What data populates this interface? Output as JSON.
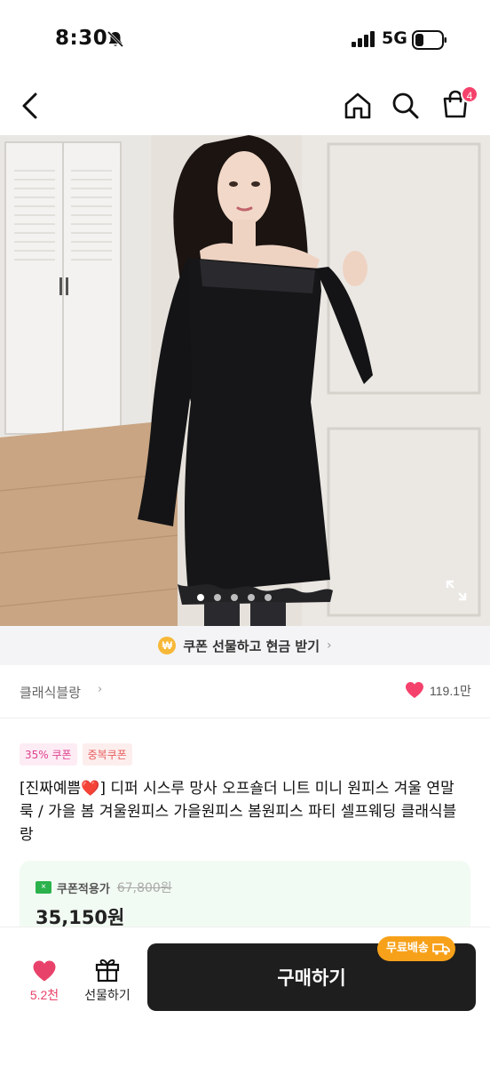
{
  "status_bar": {
    "time": "8:30",
    "network": "5G"
  },
  "nav": {
    "cart_count": "4"
  },
  "hero": {
    "image_count": 5,
    "active_index": 0
  },
  "coupon_banner": {
    "icon_text": "₩",
    "text": "쿠폰 선물하고 현금 받기",
    "chevron": "›"
  },
  "shop": {
    "name": "클래식블랑",
    "chevron": "›",
    "like_count": "119.1만"
  },
  "tags": [
    "35% 쿠폰",
    "중복쿠폰"
  ],
  "product": {
    "title": "[진짜예쁨❤️] 디퍼 시스루 망사 오프숄더 니트 미니 원피스 겨울 연말룩 / 가을 봄 겨울원피스 가을원피스 봄원피스 파티 셀프웨딩 클래식블랑"
  },
  "price": {
    "coupon_label": "쿠폰적용가",
    "original": "67,800원",
    "sale": "35,150원"
  },
  "bottom_bar": {
    "like_count": "5.2천",
    "gift_label": "선물하기",
    "buy_label": "구매하기",
    "free_shipping": "무료배송"
  },
  "colors": {
    "accent_pink": "#f5426c",
    "buy_button": "#1e1e1e",
    "shipping_badge": "#f7a11a",
    "price_box": "#f2fbf3"
  },
  "icons": [
    "back-icon",
    "home-icon",
    "search-icon",
    "cart-icon",
    "expand-icon",
    "heart-icon",
    "gift-icon",
    "truck-icon",
    "ticket-icon"
  ]
}
